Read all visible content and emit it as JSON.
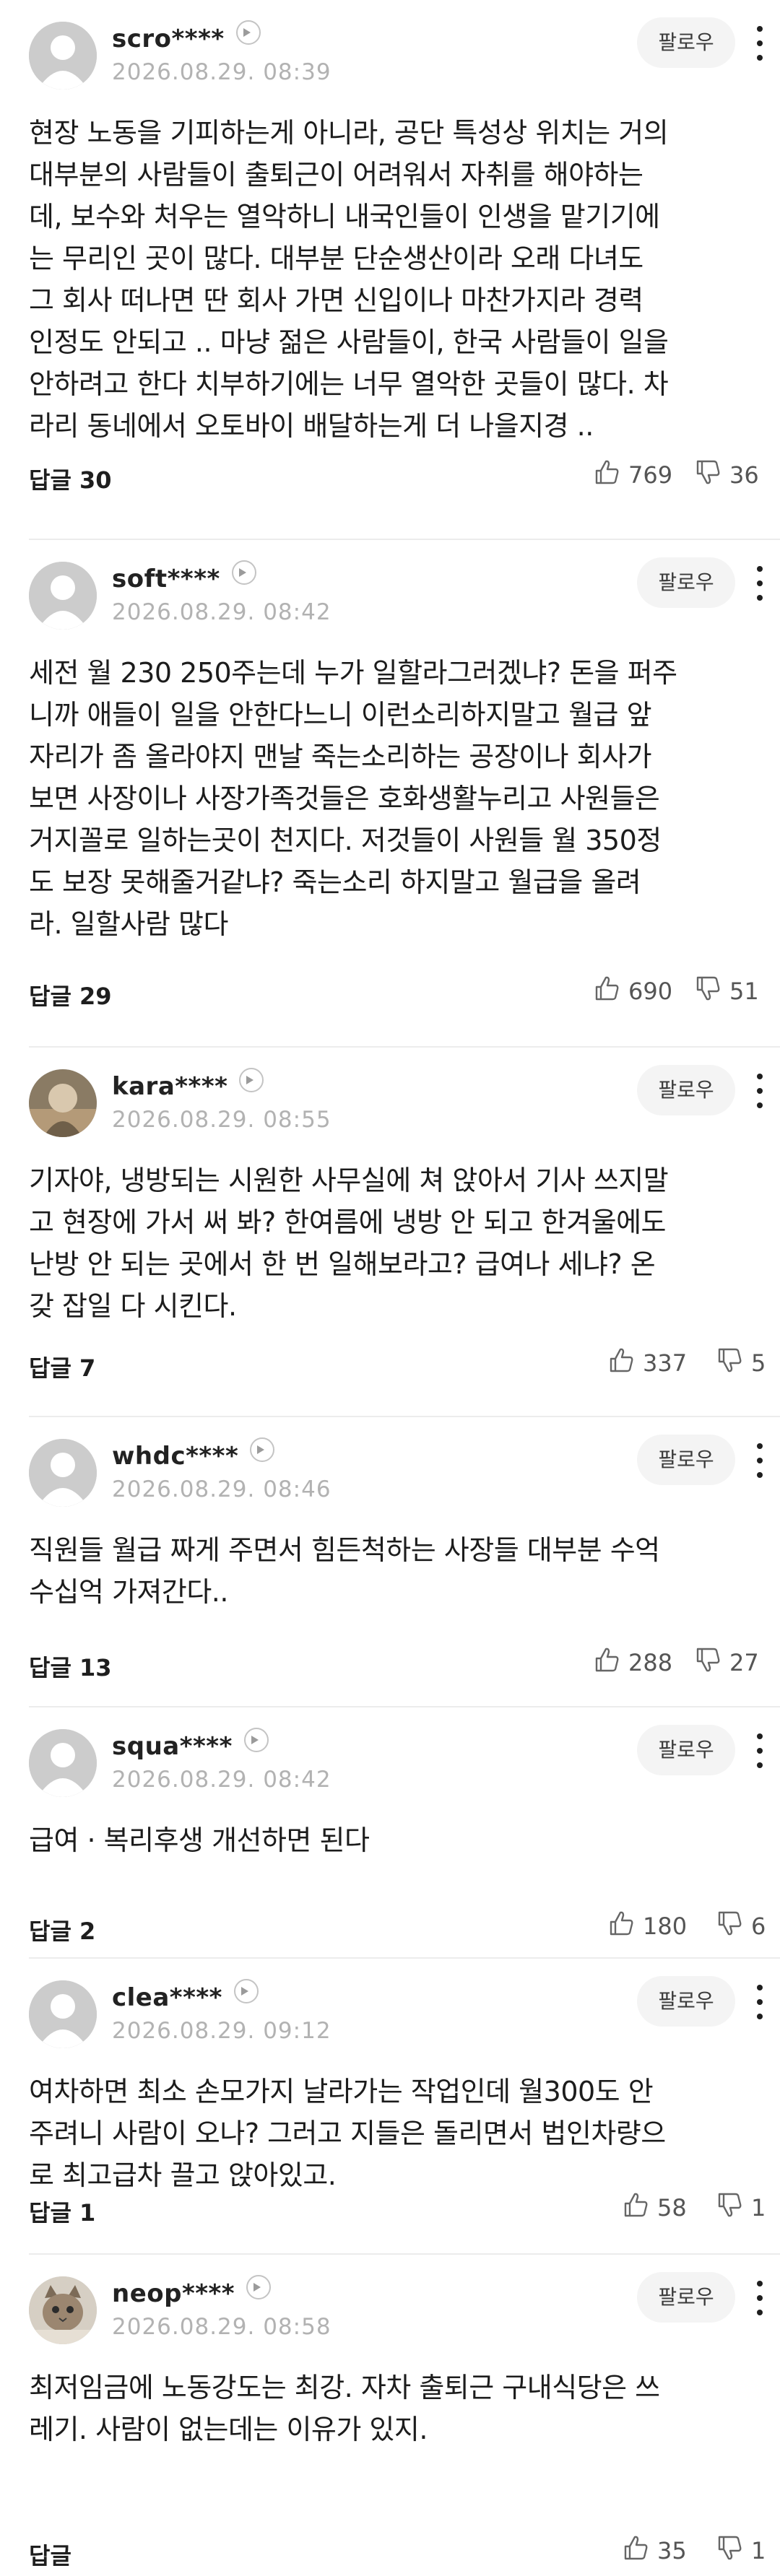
{
  "follow_label": "팔로우",
  "comments": [
    {
      "nick": "scro****",
      "date": "2026.08.29. 08:39",
      "text": "현장 노동을 기피하는게 아니라, 공단 특성상 위치는 거의\n대부분의 사람들이 출퇴근이 어려워서 자취를 해야하는\n데, 보수와 처우는 열악하니 내국인들이 인생을 맡기기에\n는 무리인 곳이 많다. 대부분 단순생산이라 오래 다녀도\n그 회사 떠나면 딴 회사 가면 신입이나 마찬가지라 경력\n인정도 안되고 .. 마냥 젊은 사람들이, 한국 사람들이 일을\n안하려고 한다 치부하기에는 너무 열악한 곳들이 많다. 차\n라리 동네에서 오토바이 배달하는게 더 나을지경 ..",
      "reply": "답글 30",
      "likes": "769",
      "dislikes": "36",
      "avatar": "default-avatar"
    },
    {
      "nick": "soft****",
      "date": "2026.08.29. 08:42",
      "text": "세전 월 230 250주는데 누가 일할라그러겠냐? 돈을 퍼주\n니까 애들이 일을 안한다느니 이런소리하지말고 월급 앞\n자리가 좀 올라야지 맨날 죽는소리하는 공장이나 회사가\n보면 사장이나 사장가족것들은 호화생활누리고 사원들은\n거지꼴로 일하는곳이 천지다. 저것들이 사원들 월 350정\n도 보장 못해줄거같냐? 죽는소리 하지말고 월급을 올려\n라. 일할사람 많다",
      "reply": "답글 29",
      "likes": "690",
      "dislikes": "51",
      "avatar": "default-avatar"
    },
    {
      "nick": "kara****",
      "date": "2026.08.29. 08:55",
      "text": "기자야, 냉방되는 시원한 사무실에 쳐 앉아서 기사 쓰지말\n고 현장에 가서 써 봐? 한여름에 냉방 안 되고 한겨울에도\n난방 안 되는 곳에서 한 번 일해보라고? 급여나 세냐? 온\n갖 잡일 다 시킨다.",
      "reply": "답글 7",
      "likes": "337",
      "dislikes": "5",
      "avatar": "photo-avatar"
    },
    {
      "nick": "whdc****",
      "date": "2026.08.29. 08:46",
      "text": "직원들 월급 짜게 주면서 힘든척하는 사장들 대부분 수억\n수십억 가져간다..",
      "reply": "답글 13",
      "likes": "288",
      "dislikes": "27",
      "avatar": "default-avatar"
    },
    {
      "nick": "squa****",
      "date": "2026.08.29. 08:42",
      "text": "급여 · 복리후생 개선하면 된다",
      "reply": "답글 2",
      "likes": "180",
      "dislikes": "6",
      "avatar": "default-avatar"
    },
    {
      "nick": "clea****",
      "date": "2026.08.29. 09:12",
      "text": "여차하면 최소 손모가지 날라가는 작업인데 월300도 안\n주려니 사람이 오나? 그러고 지들은 돌리면서 법인차량으\n로 최고급차 끌고 앉아있고.",
      "reply": "답글 1",
      "likes": "58",
      "dislikes": "1",
      "avatar": "default-avatar"
    },
    {
      "nick": "neop****",
      "date": "2026.08.29. 08:58",
      "text": "최저임금에 노동강도는 최강. 자차 출퇴근 구내식당은 쓰\n레기. 사람이 없는데는 이유가 있지.",
      "reply": "답글",
      "likes": "35",
      "dislikes": "1",
      "avatar": "cat-avatar"
    }
  ]
}
